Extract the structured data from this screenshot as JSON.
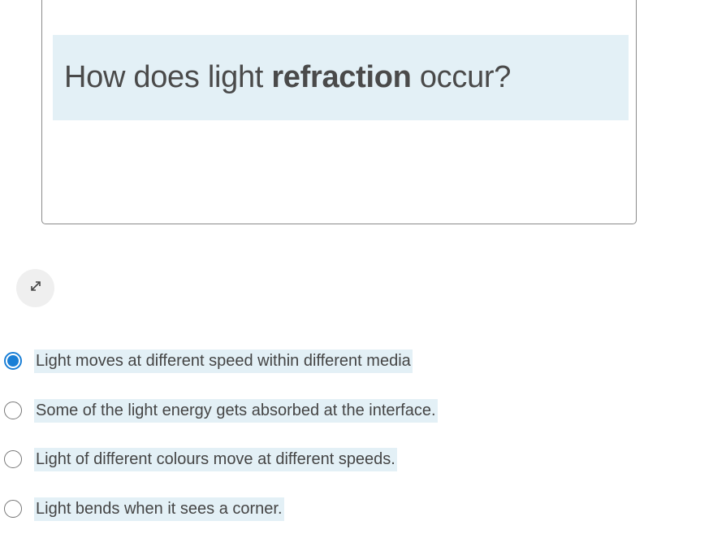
{
  "question": {
    "prefix": "How does light ",
    "emphasis": "refraction",
    "suffix": " occur?"
  },
  "expand_button": {
    "icon": "expand-arrows-icon"
  },
  "options": [
    {
      "label": "Light moves at different speed within different media",
      "selected": true
    },
    {
      "label": "Some of the light energy gets absorbed at the interface.",
      "selected": false
    },
    {
      "label": "Light of different colours move at different speeds.",
      "selected": false
    },
    {
      "label": "Light bends when it sees a corner.",
      "selected": false
    }
  ],
  "colors": {
    "highlight": "#e3f0f6",
    "selected_radio": "#1a7fd6"
  }
}
